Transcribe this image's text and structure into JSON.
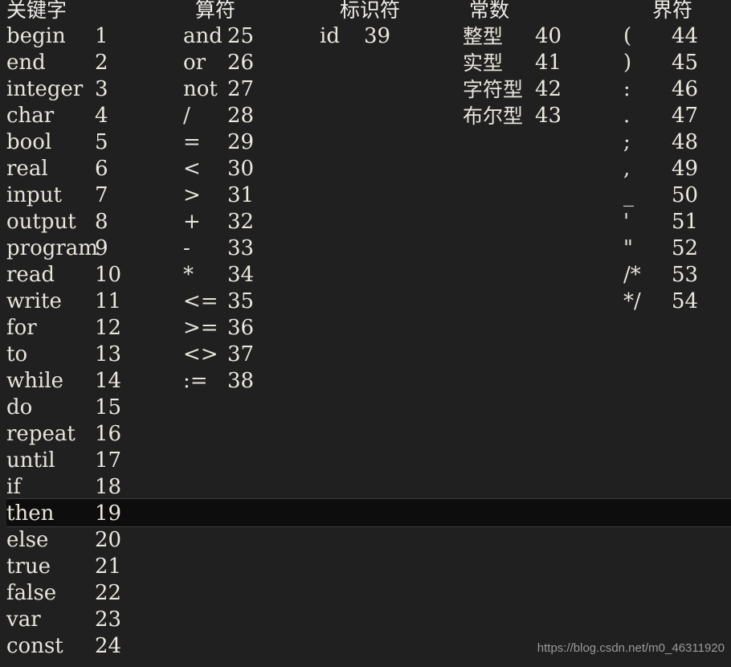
{
  "window": {
    "title": "Token Table Console Output",
    "background_color": "#202020",
    "text_color": "#e8e4dc"
  },
  "highlight": {
    "row_label": "then",
    "row_code": "19",
    "fill_color": "#0d0d0d",
    "border_color": "#3c3c3c"
  },
  "columns": {
    "keywords": {
      "header": "关键字",
      "rows": [
        {
          "label": "begin",
          "code": "1"
        },
        {
          "label": "end",
          "code": "2"
        },
        {
          "label": "integer",
          "code": "3"
        },
        {
          "label": "char",
          "code": "4"
        },
        {
          "label": "bool",
          "code": "5"
        },
        {
          "label": "real",
          "code": "6"
        },
        {
          "label": "input",
          "code": "7"
        },
        {
          "label": "output",
          "code": "8"
        },
        {
          "label": "program",
          "code": "9"
        },
        {
          "label": "read",
          "code": "10"
        },
        {
          "label": "write",
          "code": "11"
        },
        {
          "label": "for",
          "code": "12"
        },
        {
          "label": "to",
          "code": "13"
        },
        {
          "label": "while",
          "code": "14"
        },
        {
          "label": "do",
          "code": "15"
        },
        {
          "label": "repeat",
          "code": "16"
        },
        {
          "label": "until",
          "code": "17"
        },
        {
          "label": "if",
          "code": "18"
        },
        {
          "label": "then",
          "code": "19"
        },
        {
          "label": "else",
          "code": "20"
        },
        {
          "label": "true",
          "code": "21"
        },
        {
          "label": "false",
          "code": "22"
        },
        {
          "label": "var",
          "code": "23"
        },
        {
          "label": "const",
          "code": "24"
        }
      ]
    },
    "operators": {
      "header": "算符",
      "rows": [
        {
          "label": "and",
          "code": "25"
        },
        {
          "label": "or",
          "code": "26"
        },
        {
          "label": "not",
          "code": "27"
        },
        {
          "label": "/",
          "code": "28"
        },
        {
          "label": "=",
          "code": "29"
        },
        {
          "label": "<",
          "code": "30"
        },
        {
          "label": ">",
          "code": "31"
        },
        {
          "label": "+",
          "code": "32"
        },
        {
          "label": "-",
          "code": "33"
        },
        {
          "label": "*",
          "code": "34"
        },
        {
          "label": "<=",
          "code": "35"
        },
        {
          "label": ">=",
          "code": "36"
        },
        {
          "label": "<>",
          "code": "37"
        },
        {
          "label": ":=",
          "code": "38"
        }
      ]
    },
    "identifiers": {
      "header": "标识符",
      "rows": [
        {
          "label": "id",
          "code": "39"
        }
      ]
    },
    "constants": {
      "header": "常数",
      "rows": [
        {
          "label": "整型",
          "code": "40"
        },
        {
          "label": "实型",
          "code": "41"
        },
        {
          "label": "字符型",
          "code": "42"
        },
        {
          "label": "布尔型",
          "code": "43"
        }
      ]
    },
    "delimiters": {
      "header": "界符",
      "rows": [
        {
          "label": "(",
          "code": "44"
        },
        {
          "label": ")",
          "code": "45"
        },
        {
          "label": ":",
          "code": "46"
        },
        {
          "label": ".",
          "code": "47"
        },
        {
          "label": ";",
          "code": "48"
        },
        {
          "label": ",",
          "code": "49"
        },
        {
          "label": "_",
          "code": "50"
        },
        {
          "label": "'",
          "code": "51"
        },
        {
          "label": "\"",
          "code": "52"
        },
        {
          "label": "/*",
          "code": "53"
        },
        {
          "label": "*/",
          "code": "54"
        }
      ]
    }
  },
  "watermark": {
    "text": "https://blog.csdn.net/m0_46311920",
    "color": "#9a9a9a"
  }
}
